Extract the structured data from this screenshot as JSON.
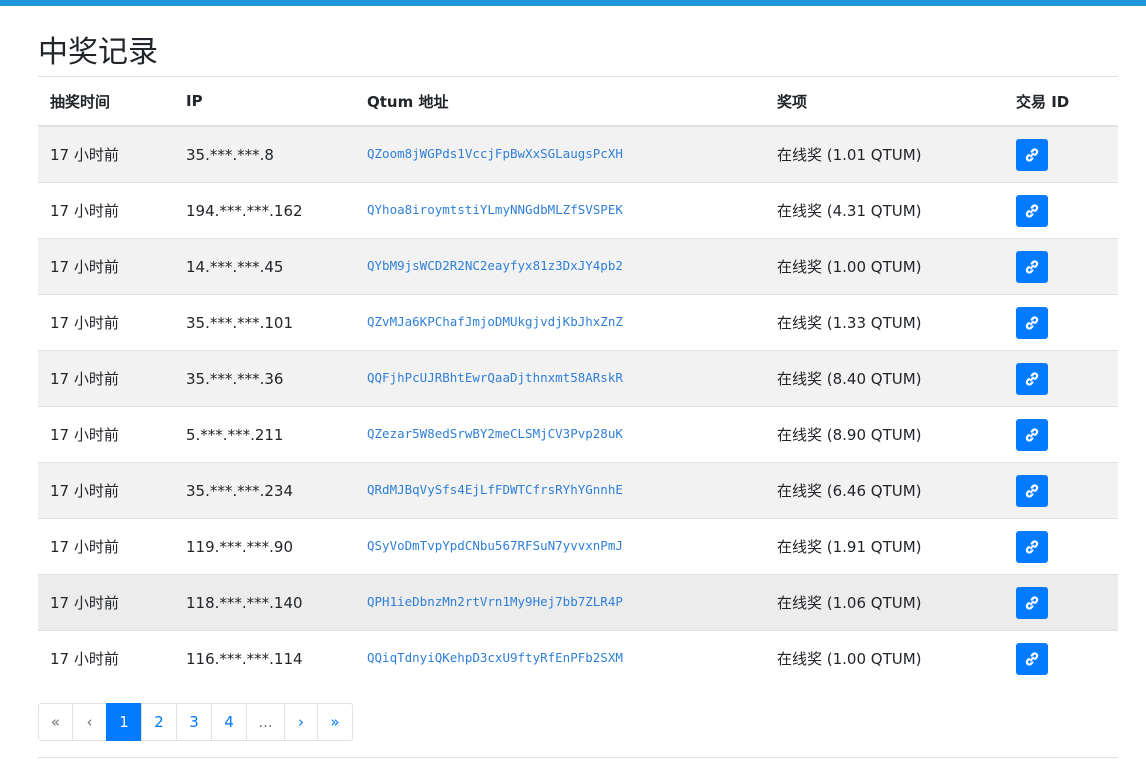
{
  "page": {
    "title": "中奖记录",
    "accent_color": "#1f98dc",
    "link_color": "#007bff"
  },
  "table": {
    "headers": {
      "time": "抽奖时间",
      "ip": "IP",
      "address": "Qtum 地址",
      "prize": "奖项",
      "tx": "交易 ID"
    },
    "tx_icon": "link-icon",
    "rows": [
      {
        "time": "17 小时前",
        "ip": "35.***.***.8",
        "address": "QZoom8jWGPds1VccjFpBwXxSGLaugsPcXH",
        "prize": "在线奖 (1.01 QTUM)"
      },
      {
        "time": "17 小时前",
        "ip": "194.***.***.162",
        "address": "QYhoa8iroymtstiYLmyNNGdbMLZfSVSPEK",
        "prize": "在线奖 (4.31 QTUM)"
      },
      {
        "time": "17 小时前",
        "ip": "14.***.***.45",
        "address": "QYbM9jsWCD2R2NC2eayfyx81z3DxJY4pb2",
        "prize": "在线奖 (1.00 QTUM)"
      },
      {
        "time": "17 小时前",
        "ip": "35.***.***.101",
        "address": "QZvMJa6KPChafJmjoDMUkgjvdjKbJhxZnZ",
        "prize": "在线奖 (1.33 QTUM)"
      },
      {
        "time": "17 小时前",
        "ip": "35.***.***.36",
        "address": "QQFjhPcUJRBhtEwrQaaDjthnxmt58ARskR",
        "prize": "在线奖 (8.40 QTUM)"
      },
      {
        "time": "17 小时前",
        "ip": "5.***.***.211",
        "address": "QZezar5W8edSrwBY2meCLSMjCV3Pvp28uK",
        "prize": "在线奖 (8.90 QTUM)"
      },
      {
        "time": "17 小时前",
        "ip": "35.***.***.234",
        "address": "QRdMJBqVySfs4EjLfFDWTCfrsRYhYGnnhE",
        "prize": "在线奖 (6.46 QTUM)"
      },
      {
        "time": "17 小时前",
        "ip": "119.***.***.90",
        "address": "QSyVoDmTvpYpdCNbu567RFSuN7yvvxnPmJ",
        "prize": "在线奖 (1.91 QTUM)"
      },
      {
        "time": "17 小时前",
        "ip": "118.***.***.140",
        "address": "QPH1ieDbnzMn2rtVrn1My9Hej7bb7ZLR4P",
        "prize": "在线奖 (1.06 QTUM)"
      },
      {
        "time": "17 小时前",
        "ip": "116.***.***.114",
        "address": "QQiqTdnyiQKehpD3cxU9ftyRfEnPFb2SXM",
        "prize": "在线奖 (1.00 QTUM)"
      }
    ]
  },
  "pagination": {
    "first": "«",
    "prev": "‹",
    "pages": [
      "1",
      "2",
      "3",
      "4"
    ],
    "ellipsis": "...",
    "next": "›",
    "last": "»",
    "active_page": "1"
  }
}
